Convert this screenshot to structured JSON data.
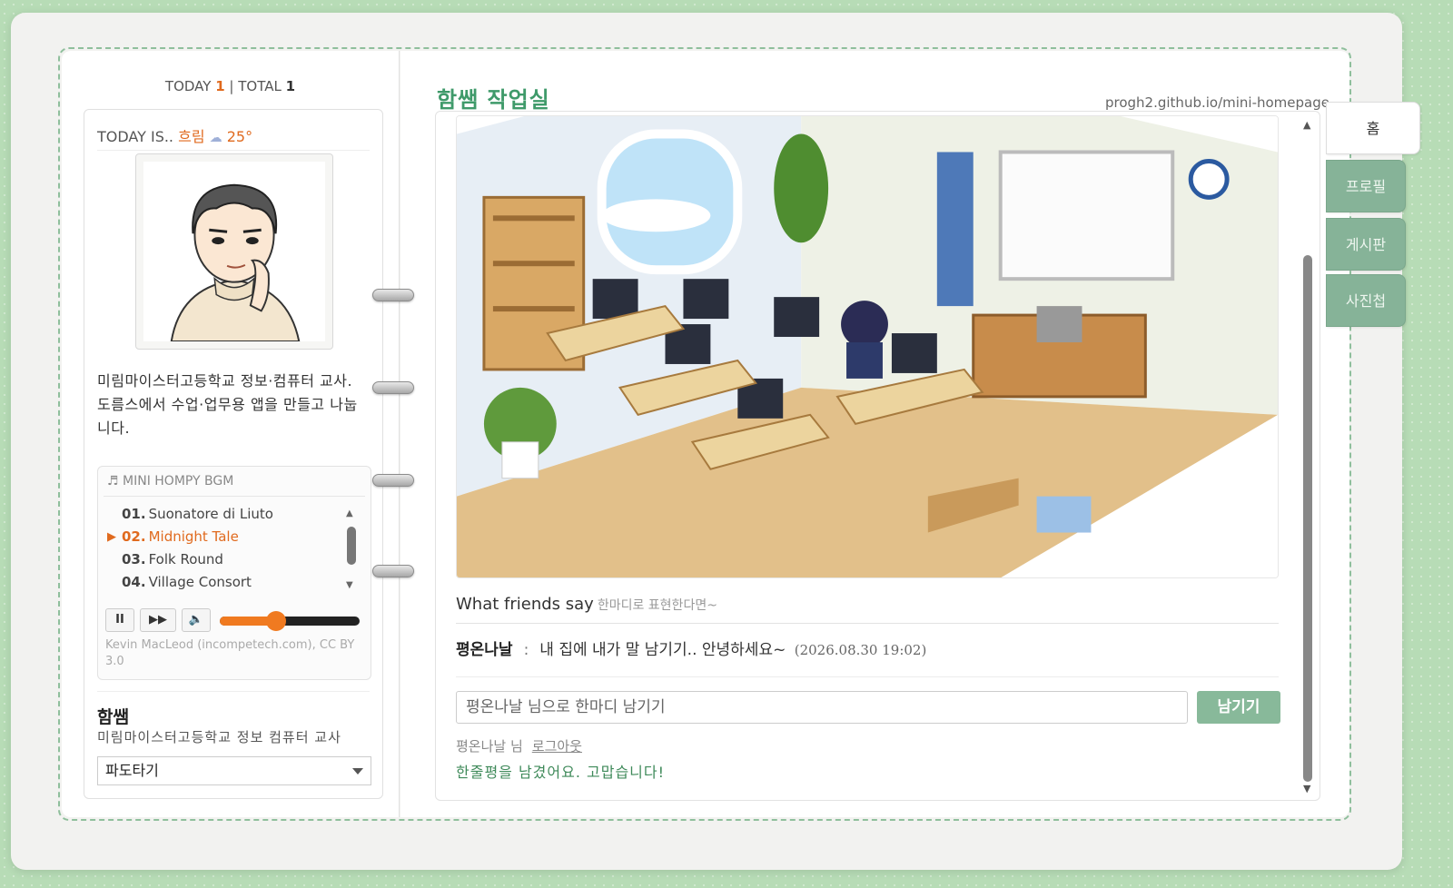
{
  "counter": {
    "today_label": "TODAY",
    "today": "1",
    "sep": "|",
    "total_label": "TOTAL",
    "total": "1"
  },
  "weather": {
    "label": "TODAY IS..",
    "condition": "흐림",
    "icon": "cloud-icon",
    "temp": "25°"
  },
  "profile": {
    "intro": "미림마이스터고등학교 정보·컴퓨터 교사. 도름스에서 수업·업무용 앱을 만들고 나눕니다.",
    "name": "함쌤",
    "job": "미림마이스터고등학교 정보 컴퓨터 교사",
    "select_value": "파도타기"
  },
  "bgm": {
    "header": "MINI HOMPY BGM",
    "tracks": [
      {
        "no": "01.",
        "title": "Suonatore di Liuto"
      },
      {
        "no": "02.",
        "title": "Midnight Tale",
        "active": true
      },
      {
        "no": "03.",
        "title": "Folk Round"
      },
      {
        "no": "04.",
        "title": "Village Consort"
      }
    ],
    "controls": {
      "pause": "II",
      "next": "▶▶",
      "mute_icon": "speaker-icon"
    },
    "volume_fraction": 0.4,
    "credit": "Kevin MacLeod (incompetech.com), CC BY 3.0"
  },
  "main": {
    "title": "함쌤 작업실",
    "url": "progh2.github.io/mini-homepage",
    "friends_title": "What friends say",
    "friends_sub": "한마디로 표현한다면~",
    "comment": {
      "who": "평온나날",
      "colon": ":",
      "text": "내 집에 내가 말 남기기.. 안녕하세요~",
      "date": "(2026.08.30 19:02)"
    },
    "input_placeholder": "평온나날 님으로 한마디 남기기",
    "submit_label": "남기기",
    "user_label": "평온나날 님",
    "logout_label": "로그아웃",
    "thanks": "한줄평을 남겼어요. 고맙습니다!"
  },
  "tabs": [
    {
      "label": "홈",
      "active": true
    },
    {
      "label": "프로필"
    },
    {
      "label": "게시판"
    },
    {
      "label": "사진첩"
    }
  ],
  "colors": {
    "accent": "#3f9a6a",
    "orange": "#e06a1e",
    "tab": "#86b398",
    "bg": "#b7dcb6"
  }
}
